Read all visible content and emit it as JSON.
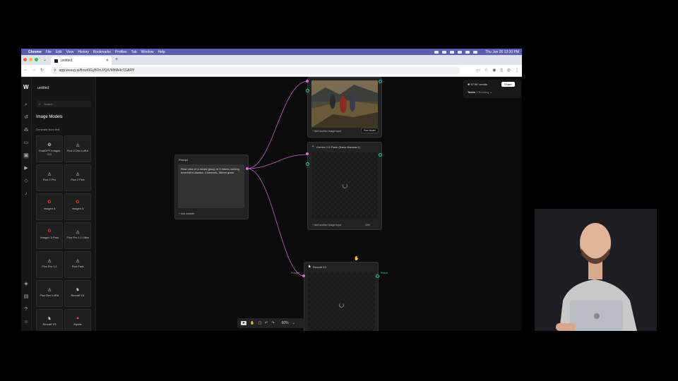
{
  "menubar": {
    "app": "Chrome",
    "items": [
      "File",
      "Edit",
      "View",
      "History",
      "Bookmarks",
      "Profiles",
      "Tab",
      "Window",
      "Help"
    ],
    "clock": "Thu Jun 26 12:20 PM"
  },
  "browser": {
    "tab_title": "untitled",
    "url": "app.weavy.ai/flow/0GyBOrLf/Q/UMMA4cTSARY"
  },
  "sidebar": {
    "project_title": "untitled",
    "search_placeholder": "Search",
    "heading": "Image Models",
    "subheading": "Generate from text",
    "models": [
      {
        "label": "ChatGPT Images 2.0",
        "icon": "openai-icon"
      },
      {
        "label": "Flux 2 Dev LoRA",
        "icon": "flux-icon"
      },
      {
        "label": "Flux 2 Pro",
        "icon": "flux-icon"
      },
      {
        "label": "Flux 2 Flex",
        "icon": "flux-icon"
      },
      {
        "label": "Imagen 4",
        "icon": "google-icon"
      },
      {
        "label": "Imagen 3",
        "icon": "google-icon"
      },
      {
        "label": "Imagen 3 Fast",
        "icon": "google-icon"
      },
      {
        "label": "Flux Pro 1.1 Ultra",
        "icon": "flux-icon"
      },
      {
        "label": "Flux Pro 1.1",
        "icon": "flux-icon"
      },
      {
        "label": "Flux Fast",
        "icon": "flux-icon"
      },
      {
        "label": "Flux Dev LoRA",
        "icon": "flux-icon"
      },
      {
        "label": "Recraft V4",
        "icon": "recraft-icon"
      },
      {
        "label": "Recraft V3",
        "icon": "recraft-icon"
      },
      {
        "label": "Mystic",
        "icon": "mystic-icon"
      }
    ]
  },
  "canvas": {
    "prompt_node": {
      "title": "Prompt",
      "text": "Rear view of a mixed group of 3 hikers running downhill in Alaska. Cinematic, 35mm grain.",
      "add_label": "+ Add variable"
    },
    "top_node": {
      "add_label": "+ Add another image input",
      "run_label": "Run Model"
    },
    "gemini_node": {
      "title": "Gemini 2.5 Flash (Nano Banana 2)",
      "add_label": "+ Add another image input",
      "progress_label": "10%"
    },
    "recraft_node": {
      "title": "Recraft V4",
      "input_label": "Prompt*",
      "output_label": "Result"
    }
  },
  "credits": {
    "amount": "97.9K credits",
    "share_label": "Share",
    "tasks_label": "Tasks",
    "tasks_status": "1 Running"
  },
  "toolbar": {
    "zoom": "60%"
  },
  "colors": {
    "wire": "#c263c2",
    "port_teal": "#2fc7a8",
    "port_pink": "#d06fd0",
    "menubar": "#5b5fb0"
  }
}
